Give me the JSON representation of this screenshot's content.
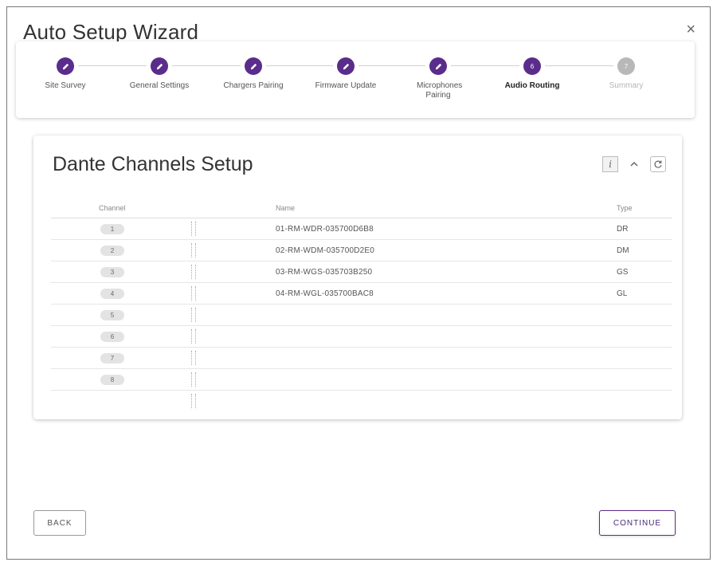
{
  "window": {
    "title": "Auto Setup Wizard",
    "close_glyph": "×"
  },
  "stepper": {
    "steps": [
      {
        "label": "Site Survey",
        "state": "done"
      },
      {
        "label": "General Settings",
        "state": "done"
      },
      {
        "label": "Chargers Pairing",
        "state": "done"
      },
      {
        "label": "Firmware Update",
        "state": "done"
      },
      {
        "label": "Microphones Pairing",
        "state": "done"
      },
      {
        "label": "Audio Routing",
        "state": "active",
        "number": "6"
      },
      {
        "label": "Summary",
        "state": "pending",
        "number": "7"
      }
    ],
    "accent_color": "#5a2d8c",
    "pending_color": "#b8b8b8"
  },
  "card": {
    "title": "Dante Channels Setup",
    "tools": [
      "info-icon",
      "collapse-icon",
      "refresh-icon"
    ],
    "columns": {
      "channel": "Channel",
      "name": "Name",
      "type": "Type"
    },
    "rows": [
      {
        "channel": "1",
        "name": "01-RM-WDR-035700D6B8",
        "type": "DR"
      },
      {
        "channel": "2",
        "name": "02-RM-WDM-035700D2E0",
        "type": "DM"
      },
      {
        "channel": "3",
        "name": "03-RM-WGS-035703B250",
        "type": "GS"
      },
      {
        "channel": "4",
        "name": "04-RM-WGL-035700BAC8",
        "type": "GL"
      },
      {
        "channel": "5",
        "name": "",
        "type": ""
      },
      {
        "channel": "6",
        "name": "",
        "type": ""
      },
      {
        "channel": "7",
        "name": "",
        "type": ""
      },
      {
        "channel": "8",
        "name": "",
        "type": ""
      },
      {
        "channel": "",
        "name": "",
        "type": ""
      }
    ]
  },
  "footer": {
    "back_label": "BACK",
    "continue_label": "CONTINUE"
  }
}
